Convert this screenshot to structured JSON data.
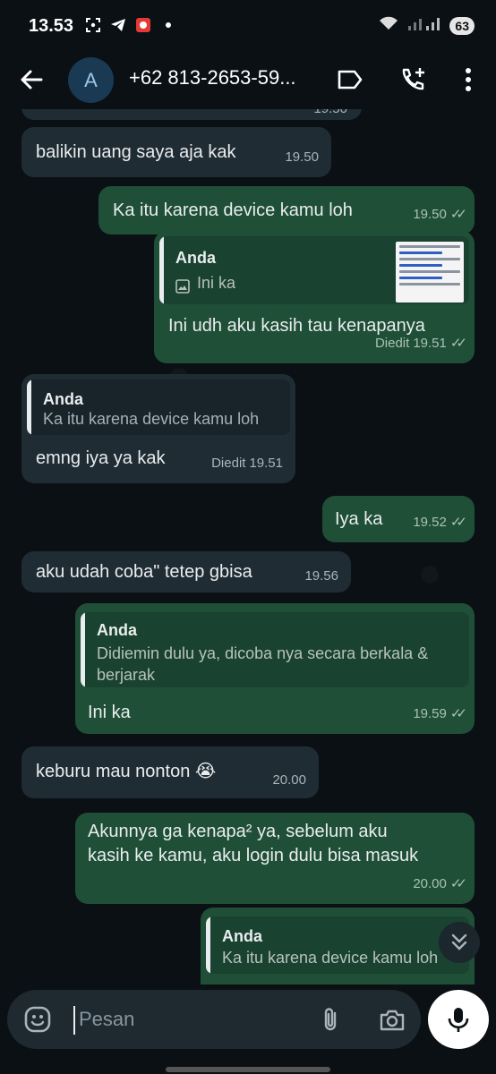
{
  "status_bar": {
    "time": "13.53",
    "battery": "63",
    "icons": [
      "screen-record-icon",
      "telegram-icon",
      "app-notification-icon",
      "dot-icon",
      "wifi-icon",
      "signal-icon"
    ]
  },
  "header": {
    "avatar_letter": "A",
    "contact_title": "+62 813-2653-59...",
    "icons": [
      "back-arrow-icon",
      "label-icon",
      "add-call-icon",
      "more-vert-icon"
    ]
  },
  "messages": [
    {
      "direction": "in",
      "text": "",
      "time": "19.50"
    },
    {
      "direction": "in",
      "text": "balikin uang saya aja kak",
      "time": "19.50"
    },
    {
      "direction": "out",
      "text": "Ka itu karena device kamu loh",
      "time": "19.50"
    },
    {
      "direction": "out",
      "quote_name": "Anda",
      "quote_text": "Ini ka",
      "text": "Ini udh aku kasih tau kenapanya",
      "edited": "Diedit",
      "time": "19.51"
    },
    {
      "direction": "in",
      "quote_name": "Anda",
      "quote_text": "Ka itu karena device kamu loh",
      "text": "emng iya ya kak",
      "edited": "Diedit",
      "time": "19.51"
    },
    {
      "direction": "out",
      "text": "Iya ka",
      "time": "19.52"
    },
    {
      "direction": "in",
      "text": "aku udah coba\" tetep gbisa",
      "time": "19.56"
    },
    {
      "direction": "out",
      "quote_name": "Anda",
      "quote_text": "Didiemin dulu ya, dicoba nya secara berkala & berjarak",
      "text": "Ini ka",
      "time": "19.59"
    },
    {
      "direction": "in",
      "text": "keburu mau nonton 😭",
      "time": "20.00"
    },
    {
      "direction": "out",
      "text": "Akunnya ga kenapa² ya, sebelum aku kasih ke kamu, aku login dulu bisa masuk",
      "time": "20.00"
    },
    {
      "direction": "out",
      "quote_name": "Anda",
      "quote_text": "Ka itu karena device kamu loh"
    }
  ],
  "composer": {
    "placeholder": "Pesan",
    "icons": [
      "emoji-icon",
      "attach-icon",
      "camera-icon",
      "mic-icon"
    ]
  },
  "colors": {
    "background": "#0b1014",
    "incoming_bubble": "#202c33",
    "outgoing_bubble": "#1f4f36",
    "text": "#e9edef"
  }
}
